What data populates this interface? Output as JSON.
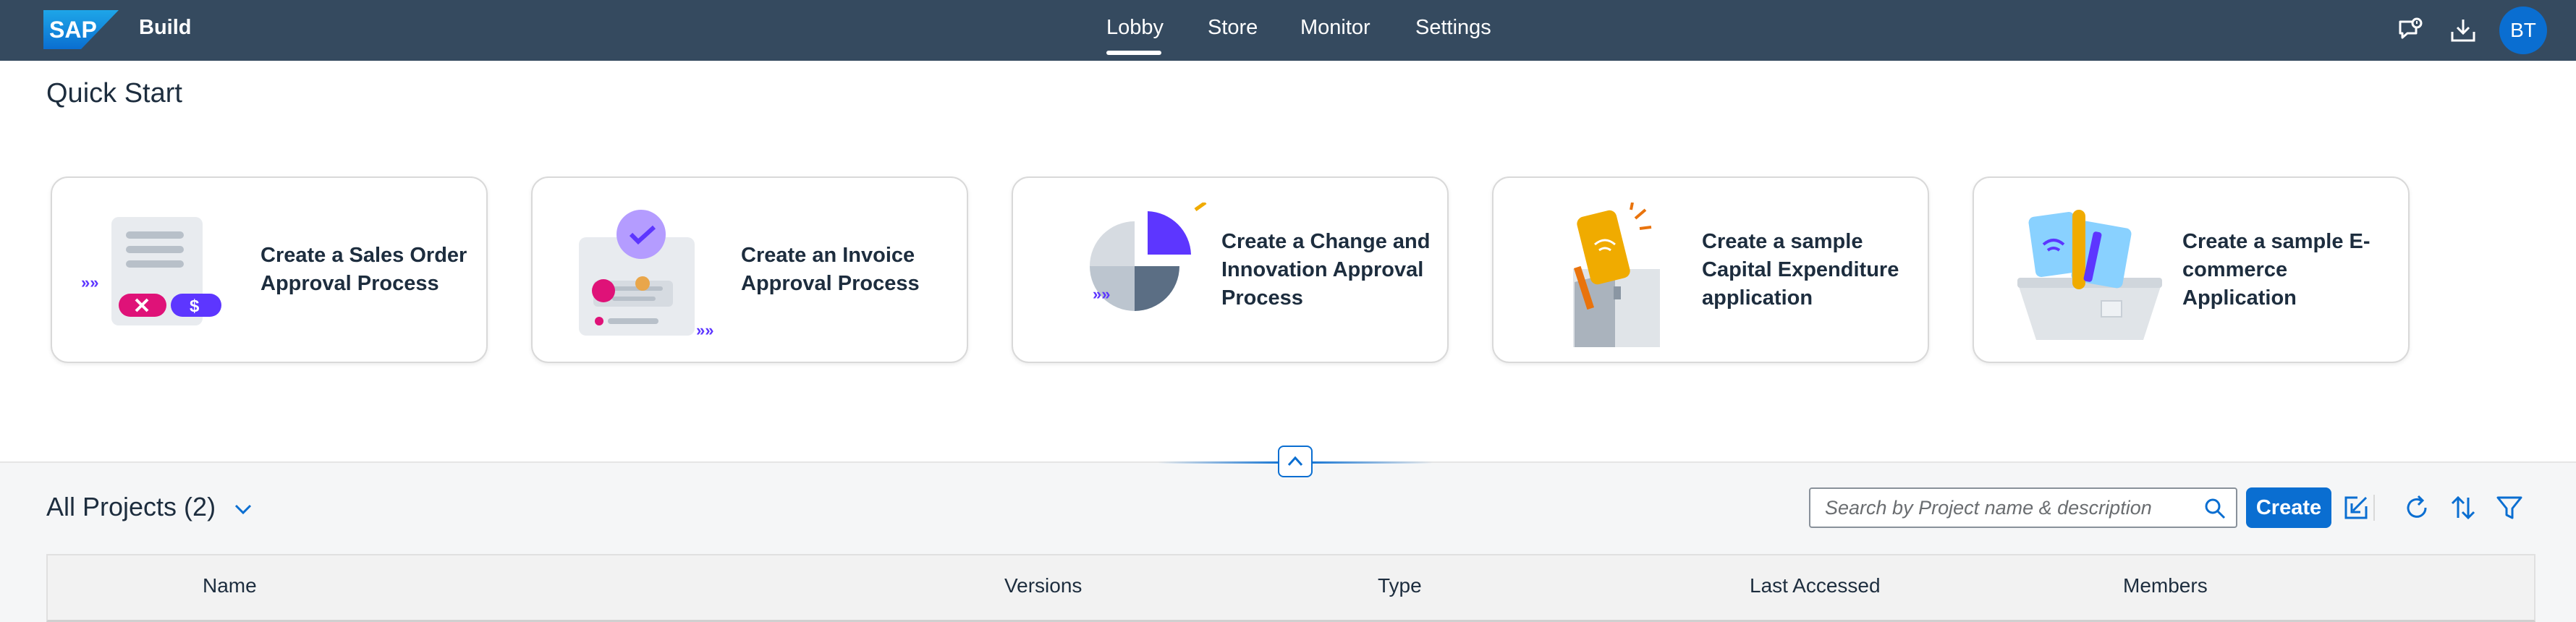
{
  "shell": {
    "brand": "SAP",
    "product": "Build",
    "nav": [
      {
        "label": "Lobby",
        "active": true
      },
      {
        "label": "Store",
        "active": false
      },
      {
        "label": "Monitor",
        "active": false
      },
      {
        "label": "Settings",
        "active": false
      }
    ],
    "icons": [
      "feedback-icon",
      "download-icon"
    ],
    "avatar_initials": "BT",
    "colors": {
      "bar": "#354a5f",
      "accent": "#0a6ed1"
    }
  },
  "quick_start": {
    "title": "Quick Start",
    "cards": [
      {
        "label": "Create a Sales Order Approval Process",
        "icon": "sales-order-illustration"
      },
      {
        "label": "Create an Invoice Approval Process",
        "icon": "invoice-illustration"
      },
      {
        "label": "Create a Change and Innovation Approval Process",
        "icon": "pie-chart-illustration"
      },
      {
        "label": "Create a sample Capital Expenditure application",
        "icon": "capex-illustration"
      },
      {
        "label": "Create a sample E-commerce Application",
        "icon": "ecommerce-illustration"
      }
    ]
  },
  "projects": {
    "title": "All Projects (2)",
    "search_placeholder": "Search by Project name & description",
    "create_label": "Create",
    "toolbar_icons": [
      "import-icon",
      "refresh-icon",
      "sort-icon",
      "filter-icon"
    ],
    "columns": [
      "Name",
      "Versions",
      "Type",
      "Last Accessed",
      "Members"
    ]
  }
}
